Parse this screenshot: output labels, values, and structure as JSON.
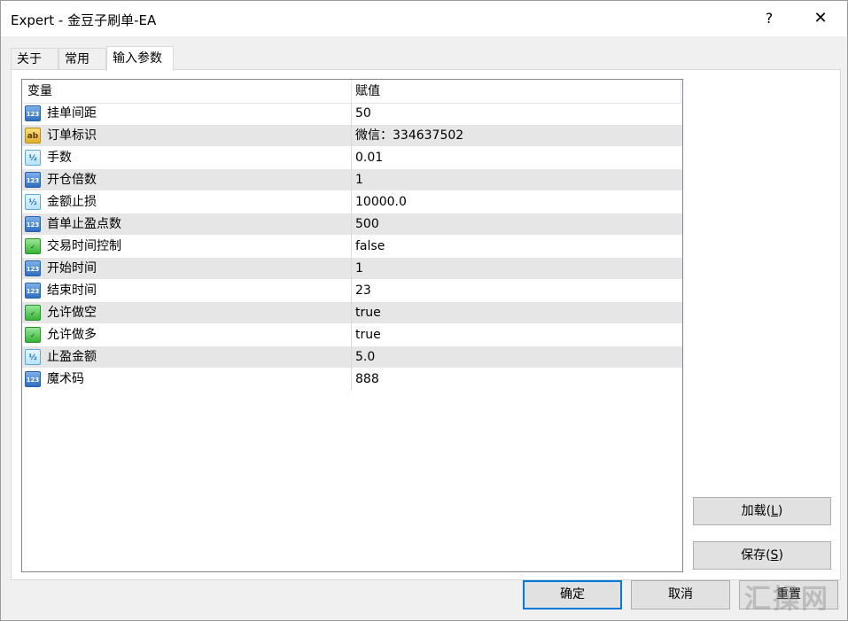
{
  "window": {
    "title": "Expert - 金豆子刷单-EA",
    "help_label": "?",
    "close_label": "✕"
  },
  "tabs": [
    {
      "label": "关于",
      "active": false
    },
    {
      "label": "常用",
      "active": false
    },
    {
      "label": "输入参数",
      "active": true
    }
  ],
  "grid": {
    "headers": {
      "variable": "变量",
      "value": "赋值"
    },
    "rows": [
      {
        "icon": "int-123-icon",
        "glyph": "123",
        "name": "挂单间距",
        "value": "50"
      },
      {
        "icon": "string-ab-icon",
        "glyph": "ab",
        "name": "订单标识",
        "value": "微信：334637502"
      },
      {
        "icon": "double-half-icon",
        "glyph": "½",
        "name": "手数",
        "value": "0.01"
      },
      {
        "icon": "int-123-icon",
        "glyph": "123",
        "name": "开仓倍数",
        "value": "1"
      },
      {
        "icon": "double-half-icon",
        "glyph": "½",
        "name": "金额止损",
        "value": "10000.0"
      },
      {
        "icon": "int-123-icon",
        "glyph": "123",
        "name": "首单止盈点数",
        "value": "500"
      },
      {
        "icon": "bool-check-icon",
        "glyph": "✓",
        "name": "交易时间控制",
        "value": "false"
      },
      {
        "icon": "int-123-icon",
        "glyph": "123",
        "name": "开始时间",
        "value": "1"
      },
      {
        "icon": "int-123-icon",
        "glyph": "123",
        "name": "结束时间",
        "value": "23"
      },
      {
        "icon": "bool-check-icon",
        "glyph": "✓",
        "name": "允许做空",
        "value": "true"
      },
      {
        "icon": "bool-check-icon",
        "glyph": "✓",
        "name": "允许做多",
        "value": "true"
      },
      {
        "icon": "double-half-icon",
        "glyph": "½",
        "name": "止盈金额",
        "value": "5.0"
      },
      {
        "icon": "int-123-icon",
        "glyph": "123",
        "name": "魔术码",
        "value": "888"
      }
    ]
  },
  "side_buttons": {
    "load_label": "加载(",
    "load_key": "L",
    "load_end": ")",
    "save_label": "保存(",
    "save_key": "S",
    "save_end": ")"
  },
  "footer": {
    "ok_label": "确定",
    "cancel_label": "取消",
    "reset_label": "重置"
  },
  "watermark": {
    "text": "汇操网"
  },
  "colors": {
    "accent": "#0078d7",
    "row_alt": "#e6e6e6",
    "panel_bg": "#f0f0f0"
  }
}
